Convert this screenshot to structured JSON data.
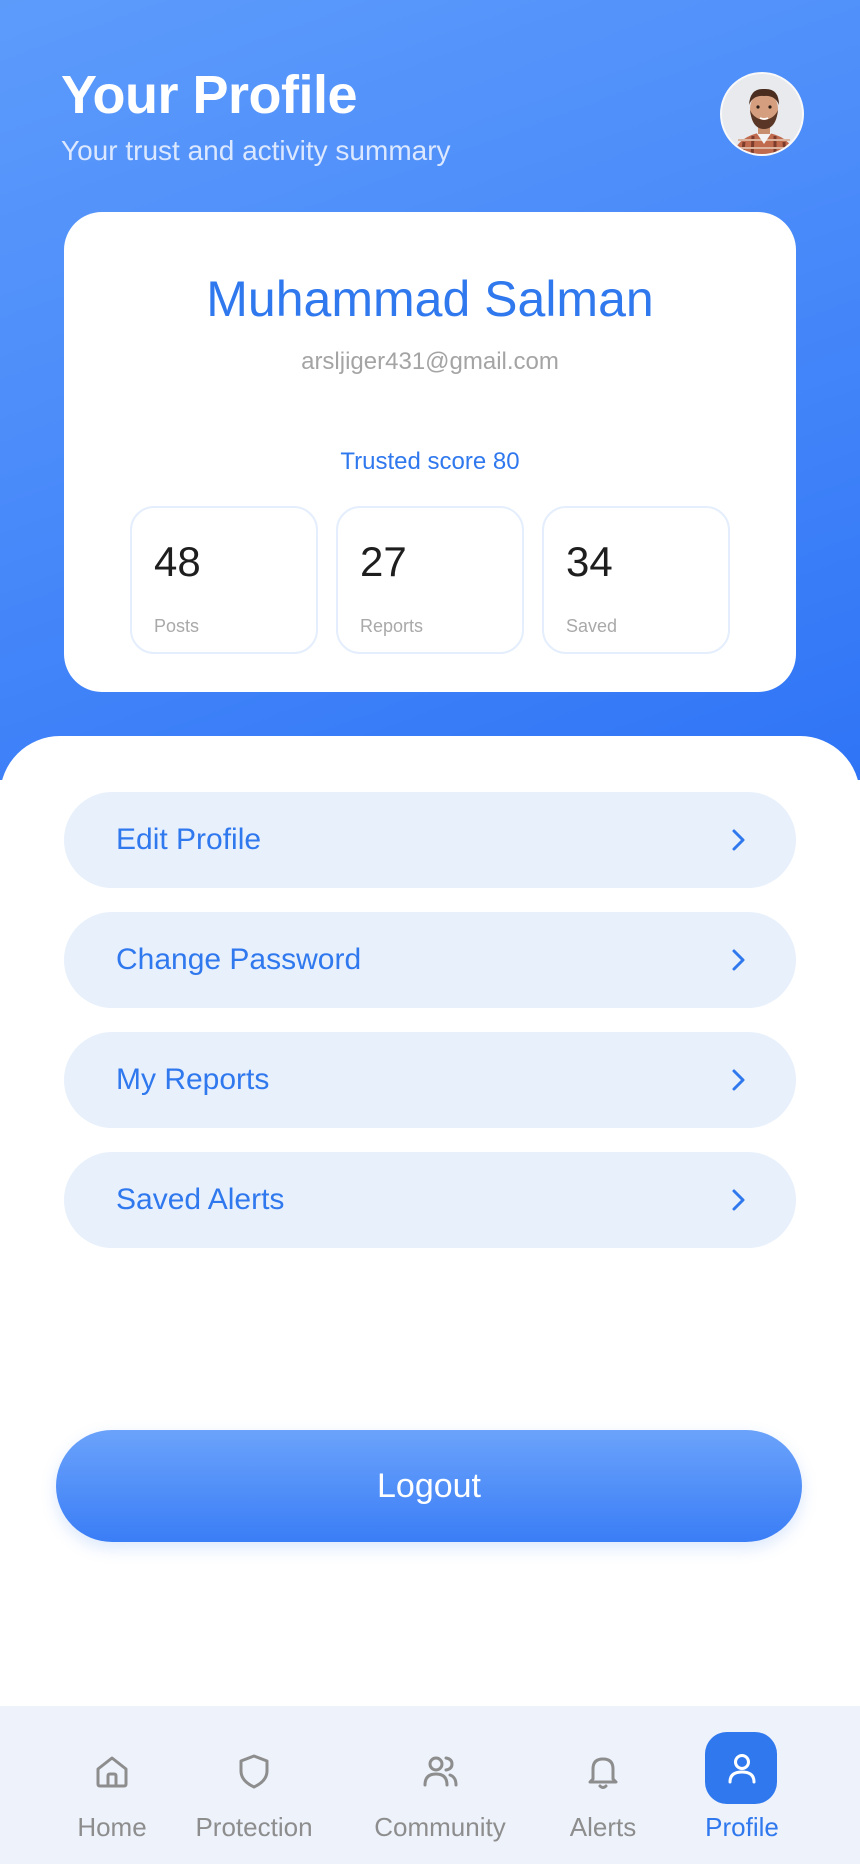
{
  "header": {
    "title": "Your Profile",
    "subtitle": "Your trust and activity summary"
  },
  "profile": {
    "name": "Muhammad Salman",
    "email": "arsljiger431@gmail.com",
    "trust_score_text": "Trusted score 80",
    "stats": [
      {
        "value": "48",
        "label": "Posts"
      },
      {
        "value": "27",
        "label": "Reports"
      },
      {
        "value": "34",
        "label": "Saved"
      }
    ]
  },
  "menu": [
    {
      "label": "Edit Profile"
    },
    {
      "label": "Change Password"
    },
    {
      "label": "My Reports"
    },
    {
      "label": "Saved Alerts"
    }
  ],
  "logout": {
    "label": "Logout"
  },
  "nav": {
    "items": [
      {
        "label": "Home",
        "icon": "home-icon"
      },
      {
        "label": "Protection",
        "icon": "shield-icon"
      },
      {
        "label": "Community",
        "icon": "users-icon"
      },
      {
        "label": "Alerts",
        "icon": "bell-icon"
      },
      {
        "label": "Profile",
        "icon": "user-icon"
      }
    ],
    "active": "Profile"
  },
  "colors": {
    "accent": "#2f78ee",
    "hero_gradient_start": "#5d9bfb",
    "hero_gradient_end": "#2f74f6",
    "menu_background": "#e8f0fc",
    "nav_background": "#edf2fb",
    "inactive_nav": "#8d8d8d"
  }
}
